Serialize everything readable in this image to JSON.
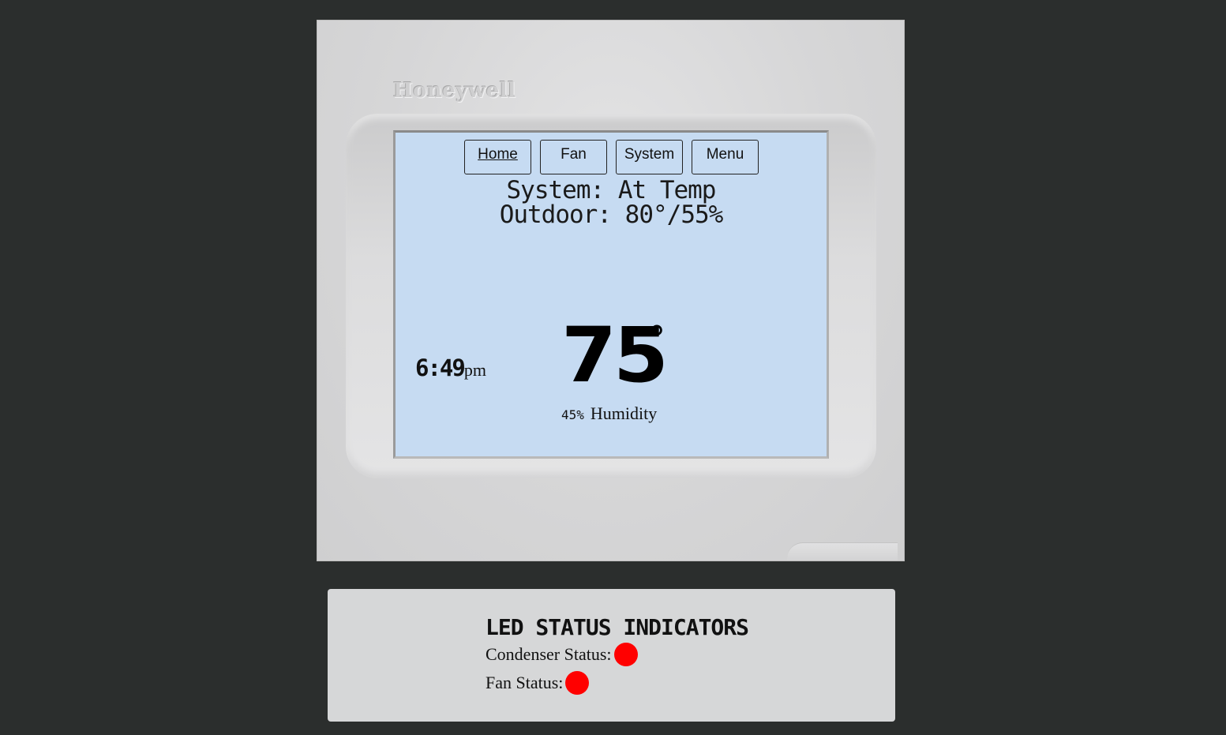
{
  "device": {
    "brand": "Honeywell"
  },
  "nav": {
    "items": [
      {
        "label": "Home",
        "active": true
      },
      {
        "label": "Fan",
        "active": false
      },
      {
        "label": "System",
        "active": false
      },
      {
        "label": "Menu",
        "active": false
      }
    ]
  },
  "screen": {
    "system_line": "System: At Temp",
    "outdoor_line": "Outdoor: 80°/55%",
    "time": "6:49",
    "ampm": "pm",
    "temperature": "75",
    "degree_symbol": "°",
    "humidity_value": "45%",
    "humidity_label": "Humidity",
    "background_color": "#c6dbf2"
  },
  "led_panel": {
    "title": "LED STATUS INDICATORS",
    "condenser_label": "Condenser Status:",
    "condenser_color": "#ff0000",
    "fan_label": "Fan Status:",
    "fan_color": "#ff0000"
  }
}
